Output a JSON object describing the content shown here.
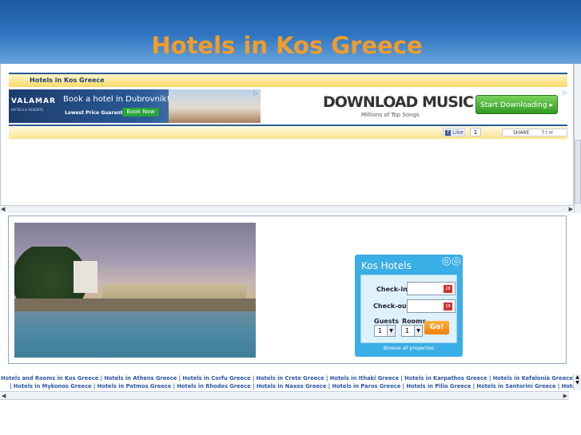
{
  "header": {
    "title": "Hotels in Kos Greece"
  },
  "nav": {
    "link": "Hotels in Kos Greece"
  },
  "ads": {
    "banner1": {
      "logo": "VALAMAR",
      "logo_sub": "HOTELS & RESORTS",
      "headline": "Book a hotel in Dubrovnik!",
      "guarantee": "Lowest Price Guarantee!",
      "button": "Book Now"
    },
    "banner2": {
      "headline": "DOWNLOAD MUSIC",
      "subline": "Millions of Top Songs",
      "button": "Start Downloading"
    }
  },
  "social": {
    "like": "Like",
    "like_count": "1",
    "share": "SHARE"
  },
  "widget": {
    "title": "Kos Hotels",
    "checkin_label": "Check-in",
    "checkout_label": "Check-out",
    "calendar_day": "28",
    "guests_label": "Guests",
    "rooms_label": "Rooms",
    "guests_value": "1",
    "rooms_value": "1",
    "go": "Go!",
    "browse": "Browse all properties"
  },
  "links": {
    "line1": "Hotels and Rooms in Kos Greece | Hotels in Athens Greece | Hotels in Corfu Greece | Hotels in Crete Greece | Hotels in Ithaki Greece | Hotels in Karpathos Greece | Hotels in Kefalonia Greece | Hotels in Lefkada Greece",
    "line2": "| Hotels in Mykonos Greece | Hotels in Patmos Greece | Hotels in Rhodes Greece | Hotels in Naxos Greece | Hotels in Paros Greece | Hotels in Pilio Greece | Hotels in Santorini Greece | Hotels in Sithonia Greece |"
  },
  "colors": {
    "title": "#f39c2a",
    "header_top": "#1b5aa0",
    "link": "#2b58a4",
    "widget": "#3aaee6"
  }
}
